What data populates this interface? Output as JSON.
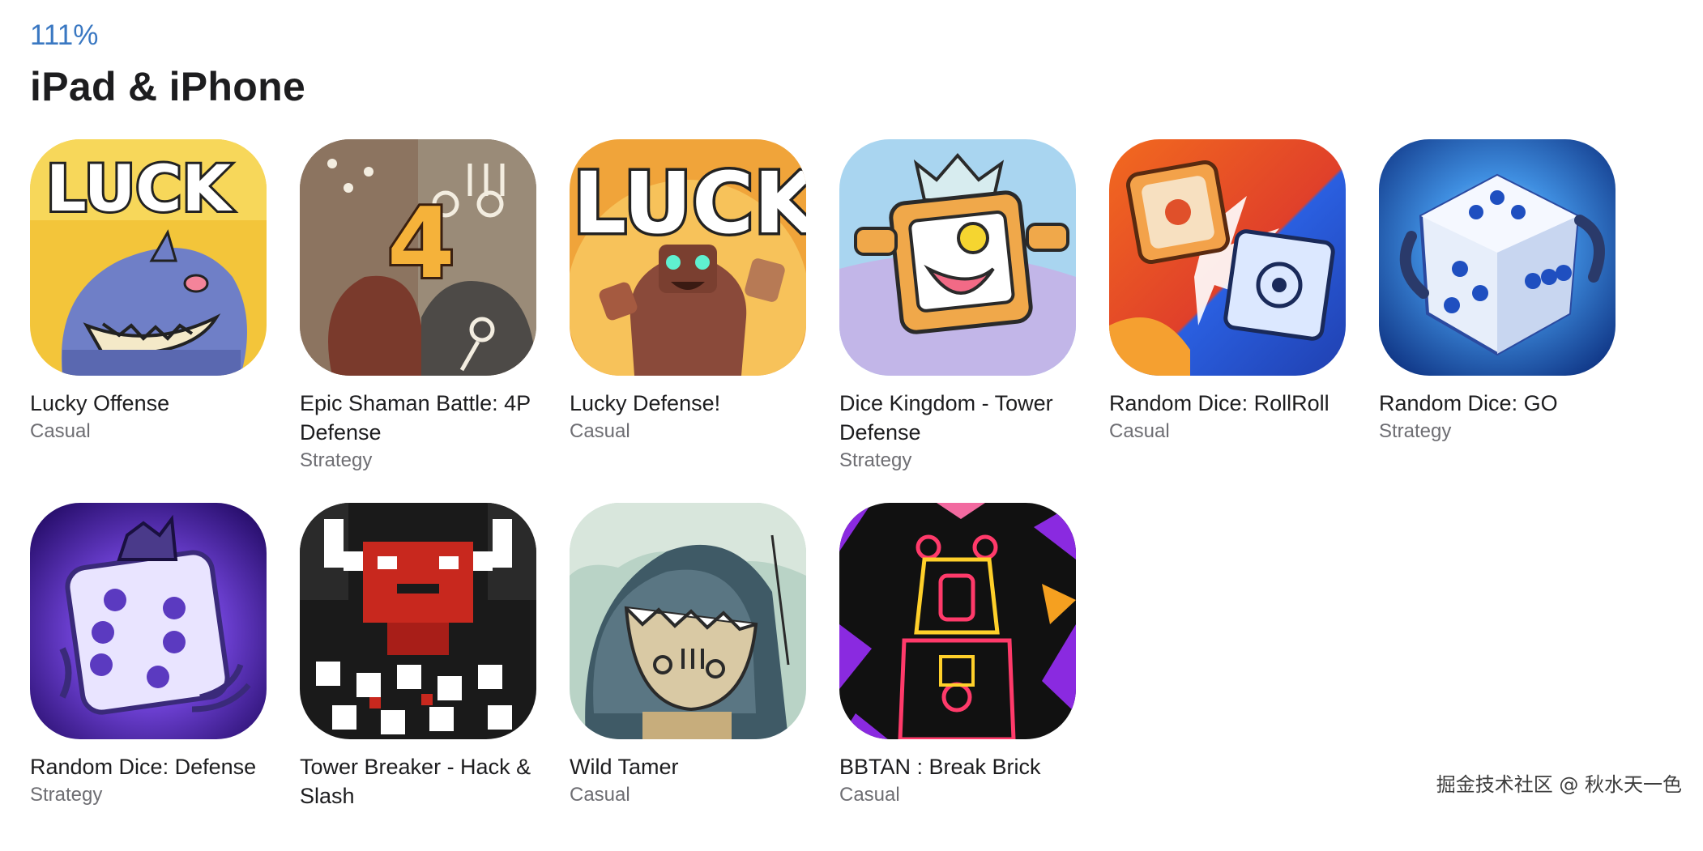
{
  "zoom_level": "111%",
  "section_title": "iPad & iPhone",
  "apps": [
    {
      "name": "Lucky Offense",
      "category": "Casual",
      "icon": "luck-shark-icon"
    },
    {
      "name": "Epic Shaman Battle: 4P Defense",
      "category": "Strategy",
      "icon": "shaman-4-icon"
    },
    {
      "name": "Lucky Defense!",
      "category": "Casual",
      "icon": "luck-golem-icon"
    },
    {
      "name": "Dice Kingdom - Tower Defense",
      "category": "Strategy",
      "icon": "tv-king-icon"
    },
    {
      "name": "Random Dice: RollRoll",
      "category": "Casual",
      "icon": "clash-dice-icon"
    },
    {
      "name": "Random Dice: GO",
      "category": "Strategy",
      "icon": "blue-dice-icon"
    },
    {
      "name": "Random Dice: Defense",
      "category": "Strategy",
      "icon": "purple-dice-icon"
    },
    {
      "name": "Tower Breaker - Hack & Slash",
      "category": "",
      "icon": "pixel-demon-icon"
    },
    {
      "name": "Wild Tamer",
      "category": "Casual",
      "icon": "wild-tamer-icon"
    },
    {
      "name": "BBTAN : Break Brick",
      "category": "Casual",
      "icon": "neon-monkey-icon"
    }
  ],
  "watermark": "掘金技术社区 @ 秋水天一色"
}
